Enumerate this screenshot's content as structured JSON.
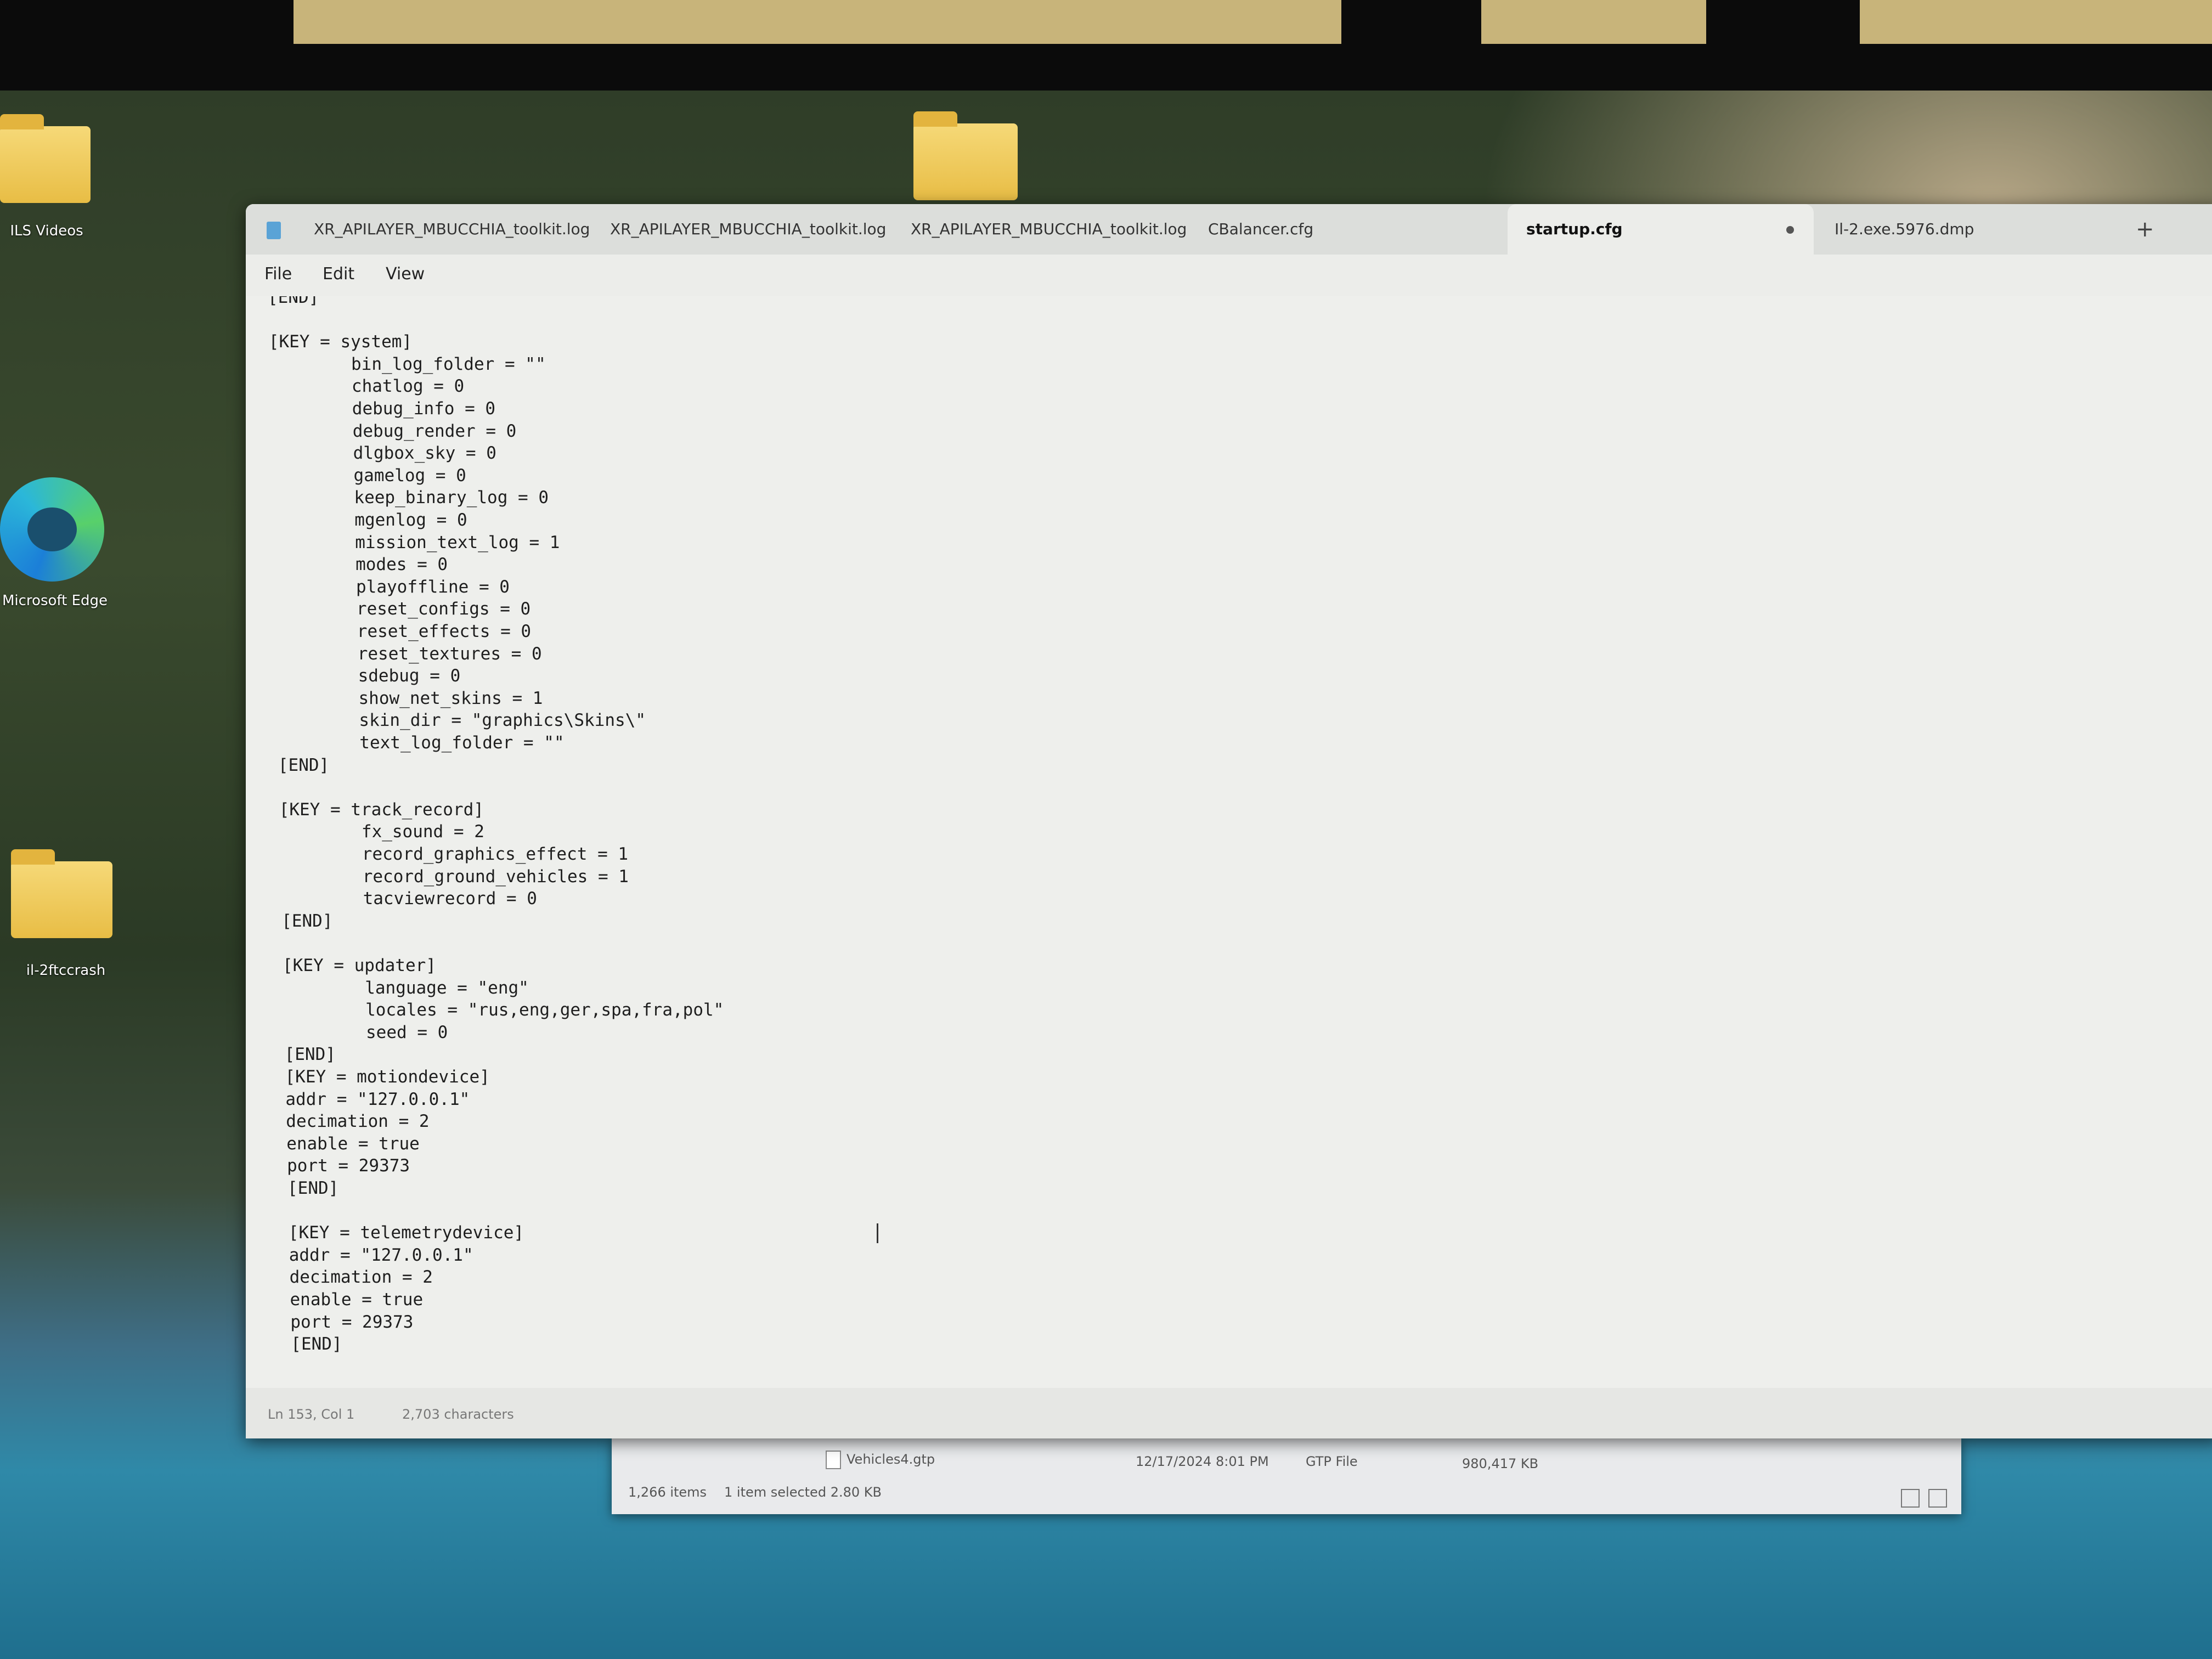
{
  "desktop": {
    "icons": [
      {
        "label": "ILS Videos",
        "kind": "folder"
      },
      {
        "label": "Microsoft Edge",
        "kind": "edge"
      },
      {
        "label": "il-2ftccrash",
        "kind": "folder"
      }
    ]
  },
  "window": {
    "tabs": [
      {
        "label": "XR_APILAYER_MBUCCHIA_toolkit.log",
        "active": false
      },
      {
        "label": "XR_APILAYER_MBUCCHIA_toolkit.log",
        "active": false
      },
      {
        "label": "XR_APILAYER_MBUCCHIA_toolkit.log",
        "active": false
      },
      {
        "label": "CBalancer.cfg",
        "active": false
      },
      {
        "label": "startup.cfg",
        "active": true
      },
      {
        "label": "Il-2.exe.5976.dmp",
        "active": false
      }
    ],
    "new_tab_label": "+",
    "menu": [
      "File",
      "Edit",
      "View"
    ],
    "lines": [
      "[END]",
      "",
      "[KEY = system]",
      "        bin_log_folder = \"\"",
      "        chatlog = 0",
      "        debug_info = 0",
      "        debug_render = 0",
      "        dlgbox_sky = 0",
      "        gamelog = 0",
      "        keep_binary_log = 0",
      "        mgenlog = 0",
      "        mission_text_log = 1",
      "        modes = 0",
      "        playoffline = 0",
      "        reset_configs = 0",
      "        reset_effects = 0",
      "        reset_textures = 0",
      "        sdebug = 0",
      "        show_net_skins = 1",
      "        skin_dir = \"graphics\\Skins\\\"",
      "        text_log_folder = \"\"",
      "[END]",
      "",
      "[KEY = track_record]",
      "        fx_sound = 2",
      "        record_graphics_effect = 1",
      "        record_ground_vehicles = 1",
      "        tacviewrecord = 0",
      "[END]",
      "",
      "[KEY = updater]",
      "        language = \"eng\"",
      "        locales = \"rus,eng,ger,spa,fra,pol\"",
      "        seed = 0",
      "[END]",
      "[KEY = motiondevice]",
      "addr = \"127.0.0.1\"",
      "decimation = 2",
      "enable = true",
      "port = 29373",
      "[END]",
      "",
      "[KEY = telemetrydevice]",
      "addr = \"127.0.0.1\"",
      "decimation = 2",
      "enable = true",
      "port = 29373",
      "[END]"
    ],
    "status": {
      "position": "Ln 153, Col 1",
      "characters": "2,703 characters"
    }
  },
  "explorer": {
    "file_name": "Vehicles4.gtp",
    "modified": "12/17/2024 8:01 PM",
    "type": "GTP File",
    "size": "980,417 KB",
    "item_count": "1,266 items",
    "selection": "1 item selected  2.80 KB"
  }
}
